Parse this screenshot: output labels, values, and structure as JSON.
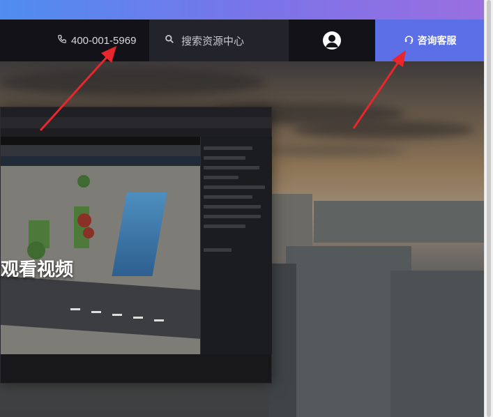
{
  "nav": {
    "phone_number": "400-001-5969",
    "search_placeholder": "搜索资源中心",
    "service_label": "咨询客服"
  },
  "hero": {
    "overlay_text": "观看视频"
  },
  "colors": {
    "accent": "#5c6fe6",
    "nav_bg": "#121218",
    "search_bg": "#23232b",
    "arrow": "#e8262b"
  },
  "icons": {
    "phone": "phone-icon",
    "search": "search-icon",
    "avatar": "user-avatar-icon",
    "service": "headset-icon"
  }
}
